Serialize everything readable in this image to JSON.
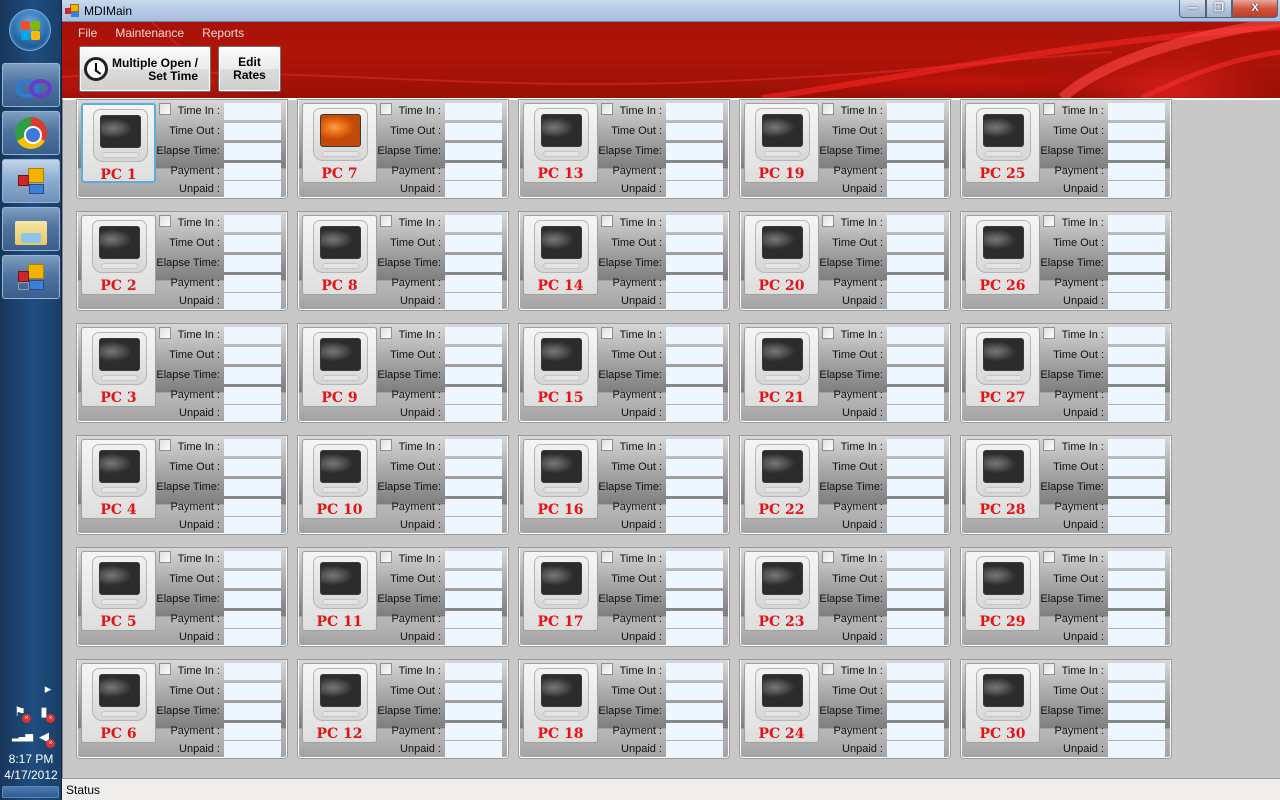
{
  "taskbar": {
    "start_icon": "windows-start-orb",
    "pinned": [
      {
        "name": "visual-studio",
        "icon": "infinity-icon",
        "active": false
      },
      {
        "name": "chrome",
        "icon": "chrome-icon",
        "active": false
      },
      {
        "name": "app-window-1",
        "icon": "tiles-app-icon",
        "active": true
      },
      {
        "name": "windows-explorer",
        "icon": "folder-icon",
        "active": false
      },
      {
        "name": "app-window-2",
        "icon": "tiles-app-icon",
        "active": false
      }
    ],
    "tray": {
      "expand_icon": "▸",
      "icons": [
        "action-center-flag-icon",
        "power-plug-icon",
        "network-signal-icon",
        "volume-muted-icon"
      ],
      "time": "8:17 PM",
      "date": "4/17/2012"
    }
  },
  "window": {
    "title": "MDIMain",
    "controls": {
      "minimize": "—",
      "restore": "❐",
      "close": "X"
    }
  },
  "menu": {
    "items": [
      "File",
      "Maintenance",
      "Reports"
    ]
  },
  "toolbar": {
    "multi_open_line1": "Multiple Open /",
    "multi_open_line2": "Set Time",
    "edit_rates_line1": "Edit",
    "edit_rates_line2": "Rates"
  },
  "field_labels": {
    "time_in": "Time In :",
    "time_out": "Time Out :",
    "elapse_time": "Elapse Time:",
    "payment": "Payment :",
    "unpaid": "Unpaid :"
  },
  "pcs": [
    {
      "name": "PC 1",
      "active": false,
      "selected": true,
      "checked": false,
      "time_in": "",
      "time_out": "",
      "elapse_time": "",
      "payment": "",
      "unpaid": ""
    },
    {
      "name": "PC 2",
      "active": false,
      "selected": false,
      "checked": false,
      "time_in": "",
      "time_out": "",
      "elapse_time": "",
      "payment": "",
      "unpaid": ""
    },
    {
      "name": "PC 3",
      "active": false,
      "selected": false,
      "checked": false,
      "time_in": "",
      "time_out": "",
      "elapse_time": "",
      "payment": "",
      "unpaid": ""
    },
    {
      "name": "PC 4",
      "active": false,
      "selected": false,
      "checked": false,
      "time_in": "",
      "time_out": "",
      "elapse_time": "",
      "payment": "",
      "unpaid": ""
    },
    {
      "name": "PC 5",
      "active": false,
      "selected": false,
      "checked": false,
      "time_in": "",
      "time_out": "",
      "elapse_time": "",
      "payment": "",
      "unpaid": ""
    },
    {
      "name": "PC 6",
      "active": false,
      "selected": false,
      "checked": false,
      "time_in": "",
      "time_out": "",
      "elapse_time": "",
      "payment": "",
      "unpaid": ""
    },
    {
      "name": "PC 7",
      "active": true,
      "selected": false,
      "checked": false,
      "time_in": "",
      "time_out": "",
      "elapse_time": "",
      "payment": "",
      "unpaid": ""
    },
    {
      "name": "PC 8",
      "active": false,
      "selected": false,
      "checked": false,
      "time_in": "",
      "time_out": "",
      "elapse_time": "",
      "payment": "",
      "unpaid": ""
    },
    {
      "name": "PC 9",
      "active": false,
      "selected": false,
      "checked": false,
      "time_in": "",
      "time_out": "",
      "elapse_time": "",
      "payment": "",
      "unpaid": ""
    },
    {
      "name": "PC 10",
      "active": false,
      "selected": false,
      "checked": false,
      "time_in": "",
      "time_out": "",
      "elapse_time": "",
      "payment": "",
      "unpaid": ""
    },
    {
      "name": "PC 11",
      "active": false,
      "selected": false,
      "checked": false,
      "time_in": "",
      "time_out": "",
      "elapse_time": "",
      "payment": "",
      "unpaid": ""
    },
    {
      "name": "PC 12",
      "active": false,
      "selected": false,
      "checked": false,
      "time_in": "",
      "time_out": "",
      "elapse_time": "",
      "payment": "",
      "unpaid": ""
    },
    {
      "name": "PC 13",
      "active": false,
      "selected": false,
      "checked": false,
      "time_in": "",
      "time_out": "",
      "elapse_time": "",
      "payment": "",
      "unpaid": ""
    },
    {
      "name": "PC 14",
      "active": false,
      "selected": false,
      "checked": false,
      "time_in": "",
      "time_out": "",
      "elapse_time": "",
      "payment": "",
      "unpaid": ""
    },
    {
      "name": "PC 15",
      "active": false,
      "selected": false,
      "checked": false,
      "time_in": "",
      "time_out": "",
      "elapse_time": "",
      "payment": "",
      "unpaid": ""
    },
    {
      "name": "PC 16",
      "active": false,
      "selected": false,
      "checked": false,
      "time_in": "",
      "time_out": "",
      "elapse_time": "",
      "payment": "",
      "unpaid": ""
    },
    {
      "name": "PC 17",
      "active": false,
      "selected": false,
      "checked": false,
      "time_in": "",
      "time_out": "",
      "elapse_time": "",
      "payment": "",
      "unpaid": ""
    },
    {
      "name": "PC 18",
      "active": false,
      "selected": false,
      "checked": false,
      "time_in": "",
      "time_out": "",
      "elapse_time": "",
      "payment": "",
      "unpaid": ""
    },
    {
      "name": "PC 19",
      "active": false,
      "selected": false,
      "checked": false,
      "time_in": "",
      "time_out": "",
      "elapse_time": "",
      "payment": "",
      "unpaid": ""
    },
    {
      "name": "PC 20",
      "active": false,
      "selected": false,
      "checked": false,
      "time_in": "",
      "time_out": "",
      "elapse_time": "",
      "payment": "",
      "unpaid": ""
    },
    {
      "name": "PC 21",
      "active": false,
      "selected": false,
      "checked": false,
      "time_in": "",
      "time_out": "",
      "elapse_time": "",
      "payment": "",
      "unpaid": ""
    },
    {
      "name": "PC 22",
      "active": false,
      "selected": false,
      "checked": false,
      "time_in": "",
      "time_out": "",
      "elapse_time": "",
      "payment": "",
      "unpaid": ""
    },
    {
      "name": "PC 23",
      "active": false,
      "selected": false,
      "checked": false,
      "time_in": "",
      "time_out": "",
      "elapse_time": "",
      "payment": "",
      "unpaid": ""
    },
    {
      "name": "PC 24",
      "active": false,
      "selected": false,
      "checked": false,
      "time_in": "",
      "time_out": "",
      "elapse_time": "",
      "payment": "",
      "unpaid": ""
    },
    {
      "name": "PC 25",
      "active": false,
      "selected": false,
      "checked": false,
      "time_in": "",
      "time_out": "",
      "elapse_time": "",
      "payment": "",
      "unpaid": ""
    },
    {
      "name": "PC 26",
      "active": false,
      "selected": false,
      "checked": false,
      "time_in": "",
      "time_out": "",
      "elapse_time": "",
      "payment": "",
      "unpaid": ""
    },
    {
      "name": "PC 27",
      "active": false,
      "selected": false,
      "checked": false,
      "time_in": "",
      "time_out": "",
      "elapse_time": "",
      "payment": "",
      "unpaid": ""
    },
    {
      "name": "PC 28",
      "active": false,
      "selected": false,
      "checked": false,
      "time_in": "",
      "time_out": "",
      "elapse_time": "",
      "payment": "",
      "unpaid": ""
    },
    {
      "name": "PC 29",
      "active": false,
      "selected": false,
      "checked": false,
      "time_in": "",
      "time_out": "",
      "elapse_time": "",
      "payment": "",
      "unpaid": ""
    },
    {
      "name": "PC 30",
      "active": false,
      "selected": false,
      "checked": false,
      "time_in": "",
      "time_out": "",
      "elapse_time": "",
      "payment": "",
      "unpaid": ""
    }
  ],
  "statusbar": {
    "text": "Status"
  }
}
